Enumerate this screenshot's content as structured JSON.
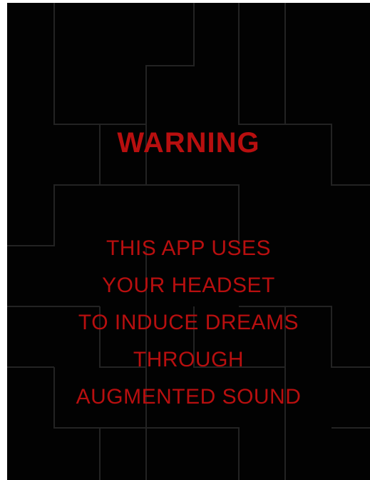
{
  "screen": {
    "title": "WARNING",
    "message_lines": [
      "THIS APP USES",
      "YOUR HEADSET",
      "TO INDUCE DREAMS",
      "THROUGH",
      "AUGMENTED SOUND"
    ]
  },
  "colors": {
    "background": "#020202",
    "text_red": "#b80f0f",
    "line_gray": "#232323"
  }
}
